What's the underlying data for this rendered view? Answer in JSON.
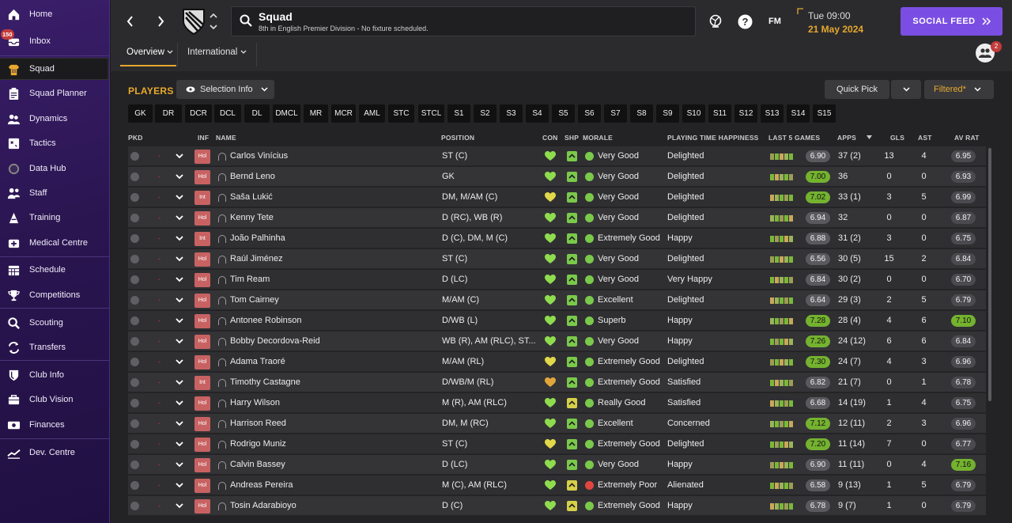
{
  "sidebar": {
    "items": [
      {
        "label": "Home",
        "icon": "home-icon"
      },
      {
        "label": "Inbox",
        "icon": "inbox-icon",
        "badge": "150"
      },
      {
        "label": "Squad",
        "icon": "shirt-icon",
        "active": true
      },
      {
        "label": "Squad Planner",
        "icon": "clipboard-icon"
      },
      {
        "label": "Dynamics",
        "icon": "people-icon"
      },
      {
        "label": "Tactics",
        "icon": "tactics-board-icon"
      },
      {
        "label": "Data Hub",
        "icon": "circle-chart-icon"
      },
      {
        "label": "Staff",
        "icon": "staff-icon"
      },
      {
        "label": "Training",
        "icon": "training-cone-icon"
      },
      {
        "label": "Medical Centre",
        "icon": "medical-cross-icon"
      },
      {
        "label": "Schedule",
        "icon": "calendar-icon"
      },
      {
        "label": "Competitions",
        "icon": "trophy-icon"
      },
      {
        "label": "Scouting",
        "icon": "magnifier-icon"
      },
      {
        "label": "Transfers",
        "icon": "transfer-arrows-icon"
      },
      {
        "label": "Club Info",
        "icon": "shield-icon"
      },
      {
        "label": "Club Vision",
        "icon": "briefcase-icon"
      },
      {
        "label": "Finances",
        "icon": "money-icon"
      },
      {
        "label": "Dev. Centre",
        "icon": "trend-icon"
      }
    ]
  },
  "header": {
    "title": "Squad",
    "subtitle": "8th in English Premier Division - No fixture scheduled.",
    "fm_label": "FM",
    "day_time": "Tue 09:00",
    "date": "21 May 2024",
    "social_feed": "SOCIAL FEED",
    "notif_count": "2",
    "tabs": [
      {
        "label": "Overview"
      },
      {
        "label": "International"
      }
    ]
  },
  "main": {
    "players_title": "PLAYERS",
    "selection_info": "Selection Info",
    "quick_pick": "Quick Pick",
    "filtered": "Filtered*",
    "positions": [
      "GK",
      "DR",
      "DCR",
      "DCL",
      "DL",
      "DMCL",
      "MR",
      "MCR",
      "AML",
      "STC",
      "STCL",
      "S1",
      "S2",
      "S3",
      "S4",
      "S5",
      "S6",
      "S7",
      "S8",
      "S9",
      "S10",
      "S11",
      "S12",
      "S13",
      "S14",
      "S15"
    ],
    "columns": {
      "pkd": "PKD",
      "inf": "INF",
      "name": "NAME",
      "position": "POSITION",
      "con": "CON",
      "shp": "SHP",
      "morale": "MORALE",
      "happiness": "PLAYING TIME HAPPINESS",
      "last5": "LAST 5 GAMES",
      "apps": "APPS",
      "gls": "GLS",
      "ast": "AST",
      "avrat": "AV RAT"
    }
  },
  "players": [
    {
      "inf": "Hol",
      "name": "Carlos Vinícius",
      "position": "ST (C)",
      "morale": "Very Good",
      "happiness": "Delighted",
      "form": "6.90",
      "apps": "37 (2)",
      "gls": "13",
      "ast": "4",
      "avrat": "6.95",
      "con": "green",
      "shp": "green",
      "mor": "green",
      "fhi": false,
      "ahi": false
    },
    {
      "inf": "Hol",
      "name": "Bernd Leno",
      "position": "GK",
      "morale": "Very Good",
      "happiness": "Delighted",
      "form": "7.00",
      "apps": "36",
      "gls": "0",
      "ast": "0",
      "avrat": "6.93",
      "con": "green",
      "shp": "green",
      "mor": "green",
      "fhi": true,
      "ahi": false
    },
    {
      "inf": "Int",
      "name": "Saša Lukić",
      "position": "DM, M/AM (C)",
      "morale": "Very Good",
      "happiness": "Delighted",
      "form": "7.02",
      "apps": "33 (1)",
      "gls": "3",
      "ast": "5",
      "avrat": "6.99",
      "con": "yellow",
      "shp": "green",
      "mor": "green",
      "fhi": true,
      "ahi": false
    },
    {
      "inf": "Hol",
      "name": "Kenny Tete",
      "position": "D (RC), WB (R)",
      "morale": "Very Good",
      "happiness": "Delighted",
      "form": "6.94",
      "apps": "32",
      "gls": "0",
      "ast": "0",
      "avrat": "6.87",
      "con": "green",
      "shp": "green",
      "mor": "green",
      "fhi": false,
      "ahi": false
    },
    {
      "inf": "Int",
      "name": "João Palhinha",
      "position": "D (C), DM, M (C)",
      "morale": "Extremely Good",
      "happiness": "Happy",
      "form": "6.88",
      "apps": "31 (2)",
      "gls": "3",
      "ast": "0",
      "avrat": "6.75",
      "con": "green",
      "shp": "green",
      "mor": "green",
      "fhi": false,
      "ahi": false
    },
    {
      "inf": "Hol",
      "name": "Raúl Jiménez",
      "position": "ST (C)",
      "morale": "Very Good",
      "happiness": "Delighted",
      "form": "6.56",
      "apps": "30 (5)",
      "gls": "15",
      "ast": "2",
      "avrat": "6.84",
      "con": "green",
      "shp": "green",
      "mor": "green",
      "fhi": false,
      "ahi": false
    },
    {
      "inf": "Hol",
      "name": "Tim Ream",
      "position": "D (LC)",
      "morale": "Very Good",
      "happiness": "Very Happy",
      "form": "6.84",
      "apps": "30 (2)",
      "gls": "0",
      "ast": "0",
      "avrat": "6.70",
      "con": "green",
      "shp": "green",
      "mor": "green",
      "fhi": false,
      "ahi": false
    },
    {
      "inf": "Hol",
      "name": "Tom Cairney",
      "position": "M/AM (C)",
      "morale": "Excellent",
      "happiness": "Delighted",
      "form": "6.64",
      "apps": "29 (3)",
      "gls": "2",
      "ast": "5",
      "avrat": "6.79",
      "con": "green",
      "shp": "green",
      "mor": "green",
      "fhi": false,
      "ahi": false
    },
    {
      "inf": "Hol",
      "name": "Antonee Robinson",
      "position": "D/WB (L)",
      "morale": "Superb",
      "happiness": "Happy",
      "form": "7.28",
      "apps": "28 (4)",
      "gls": "4",
      "ast": "6",
      "avrat": "7.10",
      "con": "green",
      "shp": "green",
      "mor": "green",
      "fhi": true,
      "ahi": true
    },
    {
      "inf": "Hol",
      "name": "Bobby Decordova-Reid",
      "position": "WB (R), AM (RLC), ST...",
      "morale": "Very Good",
      "happiness": "Happy",
      "form": "7.26",
      "apps": "24 (12)",
      "gls": "6",
      "ast": "6",
      "avrat": "6.84",
      "con": "green",
      "shp": "green",
      "mor": "green",
      "fhi": true,
      "ahi": false
    },
    {
      "inf": "Hol",
      "name": "Adama Traoré",
      "position": "M/AM (RL)",
      "morale": "Extremely Good",
      "happiness": "Delighted",
      "form": "7.30",
      "apps": "24 (7)",
      "gls": "4",
      "ast": "3",
      "avrat": "6.96",
      "con": "yellow",
      "shp": "green",
      "mor": "green",
      "fhi": true,
      "ahi": false
    },
    {
      "inf": "Int",
      "name": "Timothy Castagne",
      "position": "D/WB/M (RL)",
      "morale": "Extremely Good",
      "happiness": "Satisfied",
      "form": "6.82",
      "apps": "21 (7)",
      "gls": "0",
      "ast": "1",
      "avrat": "6.78",
      "con": "orange",
      "shp": "green",
      "mor": "green",
      "fhi": false,
      "ahi": false
    },
    {
      "inf": "Hol",
      "name": "Harry Wilson",
      "position": "M (R), AM (RLC)",
      "morale": "Really Good",
      "happiness": "Satisfied",
      "form": "6.68",
      "apps": "14 (19)",
      "gls": "1",
      "ast": "4",
      "avrat": "6.75",
      "con": "green",
      "shp": "yellow",
      "mor": "green",
      "fhi": false,
      "ahi": false
    },
    {
      "inf": "Hol",
      "name": "Harrison Reed",
      "position": "DM, M (RC)",
      "morale": "Excellent",
      "happiness": "Concerned",
      "form": "7.12",
      "apps": "12 (11)",
      "gls": "2",
      "ast": "3",
      "avrat": "6.96",
      "con": "green",
      "shp": "green",
      "mor": "green",
      "fhi": true,
      "ahi": false
    },
    {
      "inf": "Hol",
      "name": "Rodrigo Muniz",
      "position": "ST (C)",
      "morale": "Extremely Good",
      "happiness": "Delighted",
      "form": "7.20",
      "apps": "11 (14)",
      "gls": "7",
      "ast": "0",
      "avrat": "6.77",
      "con": "yellow",
      "shp": "green",
      "mor": "green",
      "fhi": true,
      "ahi": false
    },
    {
      "inf": "Hol",
      "name": "Calvin Bassey",
      "position": "D (LC)",
      "morale": "Very Good",
      "happiness": "Happy",
      "form": "6.90",
      "apps": "11 (11)",
      "gls": "0",
      "ast": "4",
      "avrat": "7.16",
      "con": "green",
      "shp": "green",
      "mor": "green",
      "fhi": false,
      "ahi": true
    },
    {
      "inf": "Hol",
      "name": "Andreas Pereira",
      "position": "M (C), AM (RLC)",
      "morale": "Extremely Poor",
      "happiness": "Alienated",
      "form": "6.58",
      "apps": "9 (13)",
      "gls": "1",
      "ast": "5",
      "avrat": "6.79",
      "con": "green",
      "shp": "yellow",
      "mor": "red",
      "fhi": false,
      "ahi": false
    },
    {
      "inf": "Hol",
      "name": "Tosin Adarabioyo",
      "position": "D (C)",
      "morale": "Extremely Good",
      "happiness": "Happy",
      "form": "6.78",
      "apps": "9 (7)",
      "gls": "1",
      "ast": "0",
      "avrat": "6.79",
      "con": "green",
      "shp": "yellow",
      "mor": "green",
      "fhi": false,
      "ahi": false
    }
  ],
  "colors": {
    "accent": "#e8a92c",
    "social": "#7b4ee3",
    "sidebar": "#2a1550",
    "good": "#74b22f",
    "red": "#c86262"
  }
}
